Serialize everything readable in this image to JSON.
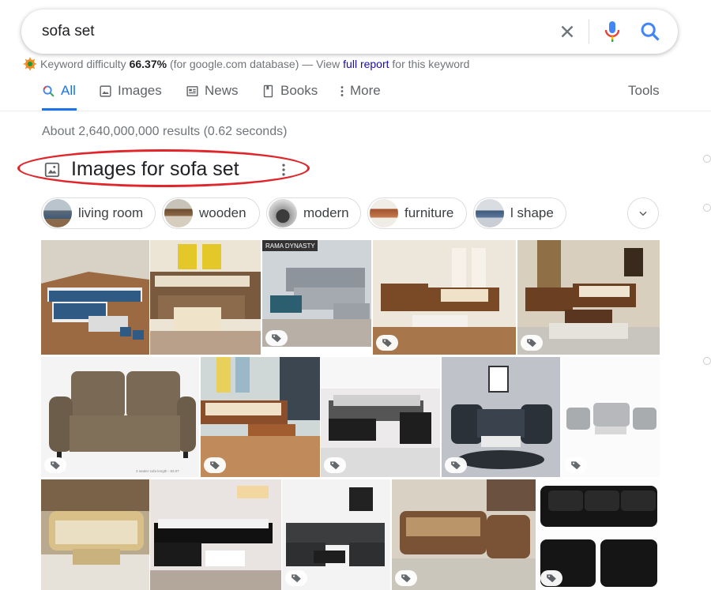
{
  "search": {
    "query": "sofa set"
  },
  "keyword_bar": {
    "prefix": "Keyword difficulty",
    "percent": "66.37%",
    "middle": "(for google.com database) — View",
    "link": "full report",
    "suffix": "for this keyword"
  },
  "tabs": [
    {
      "label": "All",
      "icon": "search-icon"
    },
    {
      "label": "Images",
      "icon": "image-icon"
    },
    {
      "label": "News",
      "icon": "news-icon"
    },
    {
      "label": "Books",
      "icon": "book-icon"
    },
    {
      "label": "More",
      "icon": "more-vert-icon"
    }
  ],
  "tools_label": "Tools",
  "stats": "About 2,640,000,000 results (0.62 seconds)",
  "images_heading": "Images for sofa set",
  "chips": [
    {
      "label": "living room"
    },
    {
      "label": "wooden"
    },
    {
      "label": "modern"
    },
    {
      "label": "furniture"
    },
    {
      "label": "l shape"
    }
  ],
  "thumb_texts": {
    "rama": "RAMA DYNASTY",
    "caption": "3 seater sofa length - 83.07"
  },
  "colors": {
    "accent": "#1a73e8",
    "link": "#1a0dab",
    "highlight_ring": "#e0262b"
  }
}
